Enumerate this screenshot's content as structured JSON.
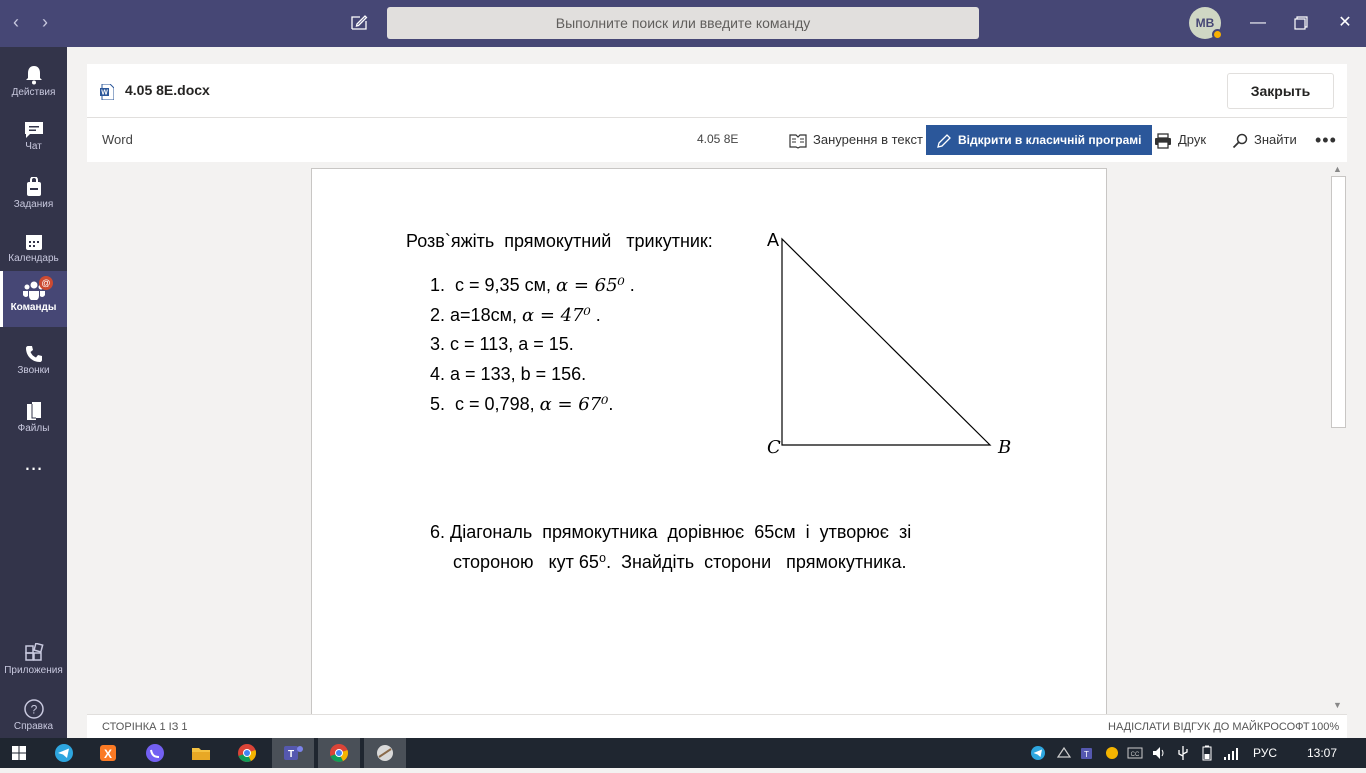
{
  "titlebar": {
    "search_placeholder": "Выполните поиск или введите команду",
    "avatar_initials": "МВ",
    "back_icon": "chevron-left-icon",
    "forward_icon": "chevron-right-icon"
  },
  "rail": {
    "items": [
      {
        "label": "Действия",
        "icon": "bell-icon"
      },
      {
        "label": "Чат",
        "icon": "chat-icon"
      },
      {
        "label": "Задания",
        "icon": "assignments-icon"
      },
      {
        "label": "Календарь",
        "icon": "calendar-icon"
      },
      {
        "label": "Команды",
        "icon": "teams-icon",
        "badge": "@",
        "active": true
      },
      {
        "label": "Звонки",
        "icon": "phone-icon"
      },
      {
        "label": "Файлы",
        "icon": "file-icon"
      },
      {
        "label": "...",
        "icon": "more-icon"
      },
      {
        "label": "Приложения",
        "icon": "apps-icon"
      },
      {
        "label": "Справка",
        "icon": "help-icon"
      }
    ]
  },
  "file": {
    "name": "4.05 8E.docx",
    "close_label": "Закрыть"
  },
  "toolbar": {
    "app": "Word",
    "doc_title": "4.05 8E",
    "immersive": "Занурення в текст",
    "open_desktop": "Відкрити в класичній програмі",
    "print": "Друк",
    "find": "Знайти"
  },
  "document": {
    "heading": "Розв`яжіть  прямокутний   трикутник:",
    "items": [
      {
        "num": "1.",
        "text": "c = 9,35 см, ",
        "math": "α = 65⁰",
        "after": " ."
      },
      {
        "num": "2.",
        "text": "a=18см, ",
        "math": "α = 47⁰",
        "after": " ."
      },
      {
        "num": "3.",
        "text": "c = 113, a = 15.",
        "math": "",
        "after": ""
      },
      {
        "num": "4.",
        "text": "a = 133, b = 156.",
        "math": "",
        "after": ""
      },
      {
        "num": "5.",
        "text": "c = 0,798, ",
        "math": "α = 67⁰",
        "after": "."
      }
    ],
    "triangle": {
      "a": "A",
      "b": "B",
      "c": "C"
    },
    "problem6_num": "6.",
    "problem6_line1": "Діагональ  прямокутника  дорівнює  65см  і  утворює  зі",
    "problem6_line2": "стороною   кут 65⁰.  Знайдіть  сторони   прямокутника."
  },
  "status": {
    "page": "СТОРІНКА 1 ІЗ 1",
    "feedback": "НАДІСЛАТИ ВІДГУК ДО МАЙКРОСОФТ",
    "zoom": "100%"
  },
  "taskbar": {
    "lang": "РУС",
    "time": "13:07"
  }
}
